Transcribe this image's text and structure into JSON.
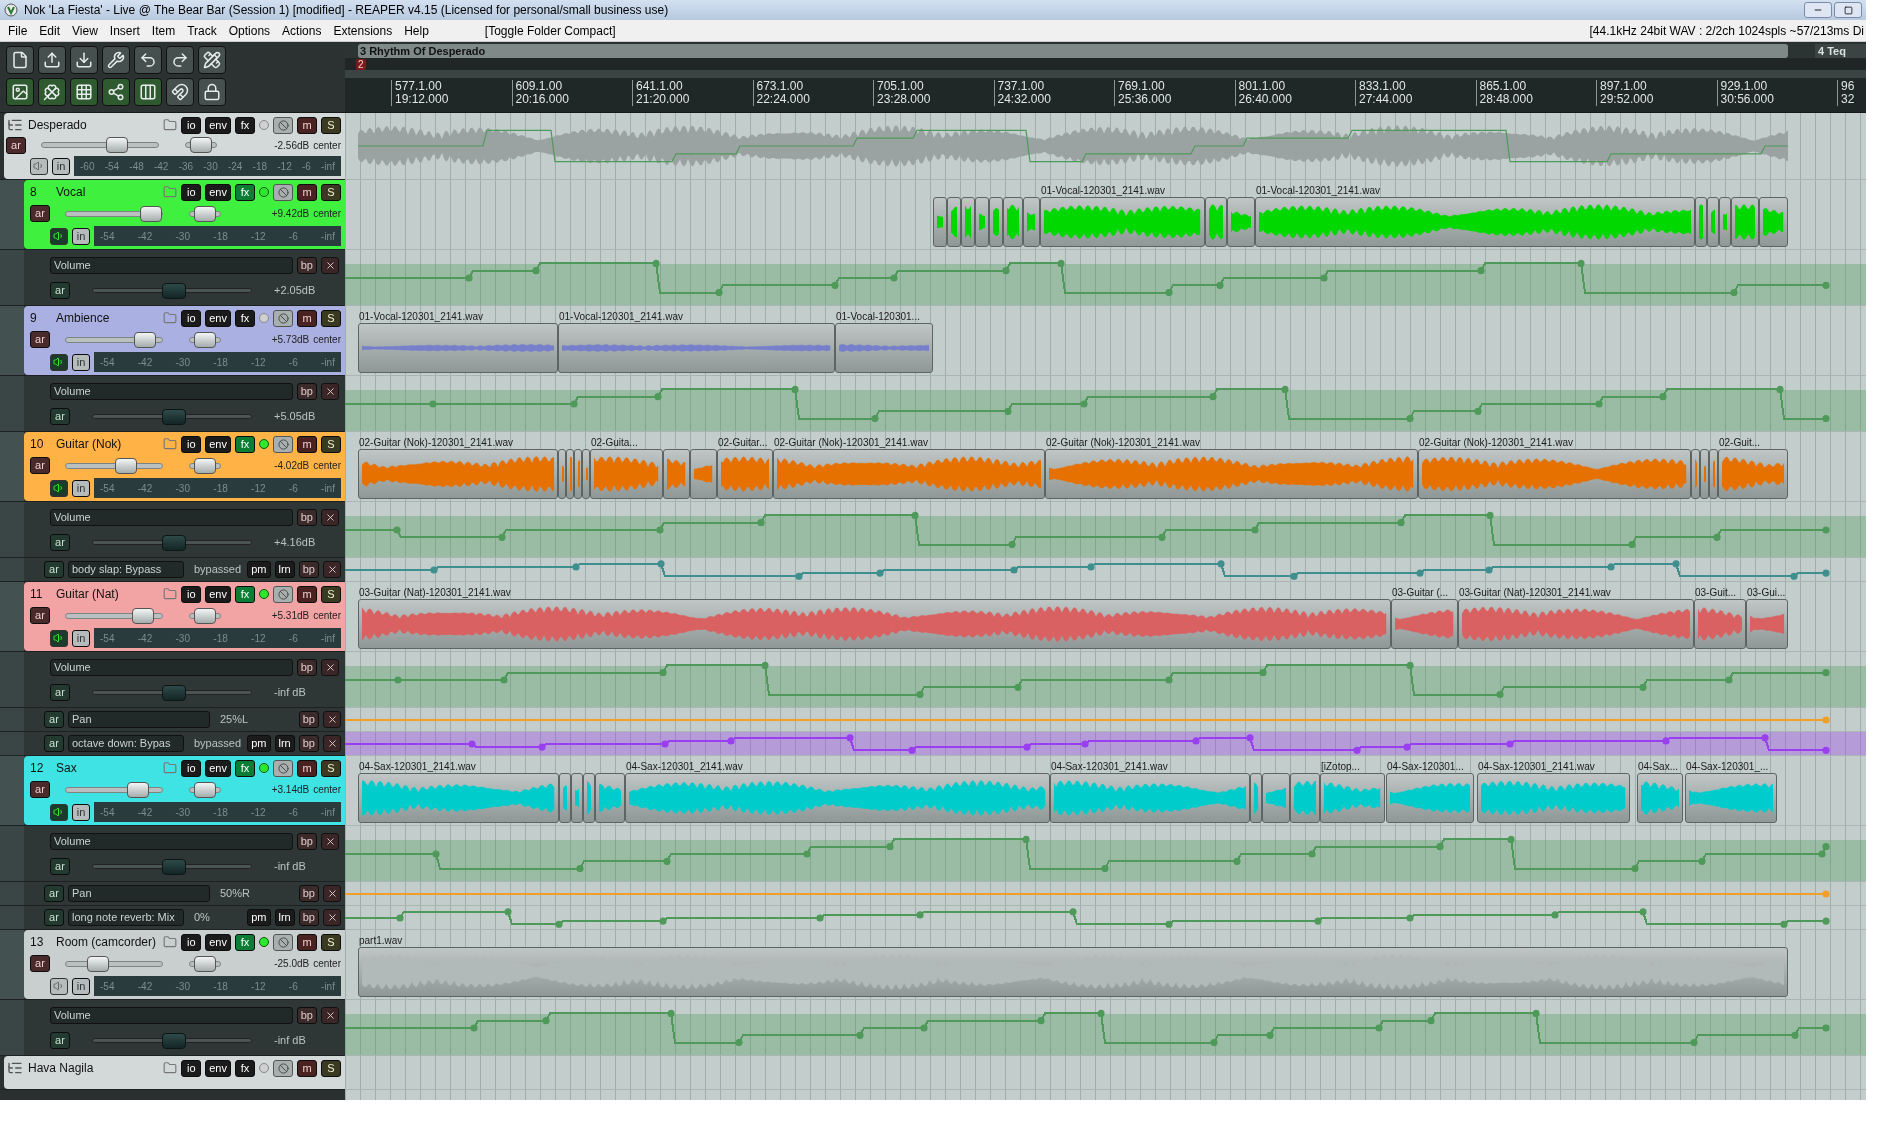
{
  "window": {
    "title": "Nok 'La Fiesta' - Live @ The Bear Bar (Session 1) [modified] - REAPER v4.15 (Licensed for personal/small business use)"
  },
  "menu": [
    {
      "label": "File"
    },
    {
      "label": "Edit"
    },
    {
      "label": "View"
    },
    {
      "label": "Insert"
    },
    {
      "label": "Item"
    },
    {
      "label": "Track"
    },
    {
      "label": "Options"
    },
    {
      "label": "Actions"
    },
    {
      "label": "Extensions"
    },
    {
      "label": "Help"
    }
  ],
  "menu_extra": "[Toggle Folder Compact]",
  "status": "[44.1kHz 24bit WAV : 2/2ch 1024spls ~57/213ms Di",
  "regions": [
    {
      "label": "3 Rhythm Of Desperado"
    },
    {
      "label": "4 Teq"
    }
  ],
  "marker": "2",
  "ruler": [
    {
      "bar": "577.1.00",
      "time": "19:12.000"
    },
    {
      "bar": "609.1.00",
      "time": "20:16.000"
    },
    {
      "bar": "641.1.00",
      "time": "21:20.000"
    },
    {
      "bar": "673.1.00",
      "time": "22:24.000"
    },
    {
      "bar": "705.1.00",
      "time": "23:28.000"
    },
    {
      "bar": "737.1.00",
      "time": "24:32.000"
    },
    {
      "bar": "769.1.00",
      "time": "25:36.000"
    },
    {
      "bar": "801.1.00",
      "time": "26:40.000"
    },
    {
      "bar": "833.1.00",
      "time": "27:44.000"
    },
    {
      "bar": "865.1.00",
      "time": "28:48.000"
    },
    {
      "bar": "897.1.00",
      "time": "29:52.000"
    },
    {
      "bar": "929.1.00",
      "time": "30:56.000"
    },
    {
      "bar": "96",
      "time": "32"
    }
  ],
  "rows": [
    {
      "kind": "folder",
      "name": "Desperado",
      "color": "#d3d9d8",
      "io": "io",
      "env": "env",
      "fx": "fx",
      "fx_on": false,
      "mute": "m",
      "solo": "S",
      "arm": "ar",
      "input": "in",
      "monitor": false,
      "readout": "-2.56dB",
      "pan_label": "center",
      "fader": {
        "level": 0.65
      },
      "pan": {
        "level": 0.5
      },
      "scale": [
        "-60",
        "-54",
        "-48",
        "-42",
        "-36",
        "-30",
        "-24",
        "-18",
        "-12",
        "-6",
        "-inf"
      ]
    },
    {
      "kind": "track",
      "number": "8",
      "name": "Vocal",
      "color": "#3ff03f",
      "io": "io",
      "env": "env",
      "fx": "fx",
      "fx_on": true,
      "mute": "m",
      "solo": "S",
      "arm": "ar",
      "input": "in",
      "monitor": true,
      "readout": "+9.42dB",
      "pan_label": "center",
      "fader": {
        "level": 0.89
      },
      "pan": {
        "level": 0.5
      },
      "scale": [
        "-54",
        "-42",
        "-30",
        "-18",
        "-12",
        "-6",
        "-inf"
      ],
      "items": [
        {
          "label": "01-Vocal-120301_2141.wav"
        },
        {
          "label": "01-Vocal-120301_2141.wav"
        }
      ]
    },
    {
      "kind": "envelope",
      "label": "Volume",
      "arm": "ar",
      "bypass": "bp",
      "readout": "+2.05dB",
      "fader": {
        "level": 0.51
      },
      "color": "#4f9a5a",
      "band": true
    },
    {
      "kind": "track",
      "number": "9",
      "name": "Ambience",
      "color": "#aab0e2",
      "io": "io",
      "env": "env",
      "fx": "fx",
      "fx_on": false,
      "mute": "m",
      "solo": "S",
      "arm": "ar",
      "input": "in",
      "monitor": true,
      "readout": "+5.73dB",
      "pan_label": "center",
      "fader": {
        "level": 0.82
      },
      "pan": {
        "level": 0.5
      },
      "scale": [
        "-54",
        "-42",
        "-30",
        "-18",
        "-12",
        "-6",
        "-inf"
      ],
      "items": [
        {
          "label": "01-Vocal-120301_2141.wav"
        },
        {
          "label": "01-Vocal-120301_2141.wav"
        },
        {
          "label": "01-Vocal-120301..."
        }
      ]
    },
    {
      "kind": "envelope",
      "label": "Volume",
      "arm": "ar",
      "bypass": "bp",
      "readout": "+5.05dB",
      "fader": {
        "level": 0.51
      },
      "color": "#4f9a5a",
      "band": true
    },
    {
      "kind": "track",
      "number": "10",
      "name": "Guitar (Nok)",
      "color": "#ffb347",
      "io": "io",
      "env": "env",
      "fx": "fx",
      "fx_on": true,
      "mute": "m",
      "solo": "S",
      "arm": "ar",
      "input": "in",
      "monitor": true,
      "readout": "-4.02dB",
      "pan_label": "center",
      "fader": {
        "level": 0.62
      },
      "pan": {
        "level": 0.5
      },
      "scale": [
        "-54",
        "-42",
        "-30",
        "-18",
        "-12",
        "-6",
        "-inf"
      ],
      "items": [
        {
          "label": "02-Guitar (Nok)-120301_2141.wav"
        },
        {
          "label": "02-Guita..."
        },
        {
          "label": "02-Guitar..."
        },
        {
          "label": "02-Guitar (Nok)-120301_2141.wav"
        },
        {
          "label": "02-Guitar (Nok)-120301_2141.wav"
        },
        {
          "label": "02-Guitar (Nok)-120301_2141.wav"
        },
        {
          "label": "02-Guit..."
        }
      ]
    },
    {
      "kind": "envelope",
      "label": "Volume",
      "arm": "ar",
      "bypass": "bp",
      "readout": "+4.16dB",
      "fader": {
        "level": 0.51
      },
      "color": "#4f9a5a",
      "band": true
    },
    {
      "kind": "fxparam",
      "label": "body slap: Bypass",
      "arm": "ar",
      "readout": "bypassed",
      "pm": "pm",
      "learn": "lrn",
      "bypass": "bp",
      "color": "#3f8f8f",
      "band": false
    },
    {
      "kind": "track",
      "number": "11",
      "name": "Guitar (Nat)",
      "color": "#f2a3a3",
      "io": "io",
      "env": "env",
      "fx": "fx",
      "fx_on": true,
      "mute": "m",
      "solo": "S",
      "arm": "ar",
      "input": "in",
      "monitor": true,
      "readout": "+5.31dB",
      "pan_label": "center",
      "fader": {
        "level": 0.8
      },
      "pan": {
        "level": 0.5
      },
      "scale": [
        "-54",
        "-42",
        "-30",
        "-18",
        "-12",
        "-6",
        "-inf"
      ],
      "items": [
        {
          "label": "03-Guitar (Nat)-120301_2141.wav"
        },
        {
          "label": "03-Guitar (..."
        },
        {
          "label": "03-Guitar (Nat)-120301_2141.wav"
        },
        {
          "label": "03-Guit..."
        },
        {
          "label": "03-Gui..."
        }
      ]
    },
    {
      "kind": "envelope",
      "label": "Volume",
      "arm": "ar",
      "bypass": "bp",
      "readout": "-inf dB",
      "fader": {
        "level": 0.51
      },
      "color": "#4f9a5a",
      "band": true
    },
    {
      "kind": "param",
      "label": "Pan",
      "arm": "ar",
      "bypass": "bp",
      "readout": "25%L",
      "color": "#f0a028",
      "band": false
    },
    {
      "kind": "fxparam",
      "label": "octave down: Bypas",
      "arm": "ar",
      "readout": "bypassed",
      "pm": "pm",
      "learn": "lrn",
      "bypass": "bp",
      "color": "#9a3ff0",
      "band": true
    },
    {
      "kind": "track",
      "number": "12",
      "name": "Sax",
      "color": "#3fe3e3",
      "io": "io",
      "env": "env",
      "fx": "fx",
      "fx_on": true,
      "mute": "m",
      "solo": "S",
      "arm": "ar",
      "input": "in",
      "monitor": true,
      "readout": "+3.14dB",
      "pan_label": "center",
      "fader": {
        "level": 0.75
      },
      "pan": {
        "level": 0.5
      },
      "scale": [
        "-54",
        "-42",
        "-30",
        "-18",
        "-12",
        "-6",
        "-inf"
      ],
      "items": [
        {
          "label": "04-Sax-120301_2141.wav"
        },
        {
          "label": "04-Sax-120301_2141.wav"
        },
        {
          "label": "04-Sax-120301_2141.wav"
        },
        {
          "label": "[iZotop..."
        },
        {
          "label": "04-Sax-120301..."
        },
        {
          "label": "04-Sax-120301_2141.wav"
        },
        {
          "label": "04-Sax..."
        },
        {
          "label": "04-Sax-120301_..."
        }
      ]
    },
    {
      "kind": "envelope",
      "label": "Volume",
      "arm": "ar",
      "bypass": "bp",
      "readout": "-inf dB",
      "fader": {
        "level": 0.51
      },
      "color": "#4f9a5a",
      "band": true
    },
    {
      "kind": "param",
      "label": "Pan",
      "arm": "ar",
      "bypass": "bp",
      "readout": "50%R",
      "color": "#f0a028",
      "band": false
    },
    {
      "kind": "fxparam",
      "label": "long note reverb: Mix",
      "arm": "ar",
      "readout": "0%",
      "pm": "pm",
      "learn": "lrn",
      "bypass": "bp",
      "color": "#4f9a5a",
      "band": false
    },
    {
      "kind": "track",
      "number": "13",
      "name": "Room (camcorder)",
      "color": "#c9cfce",
      "io": "io",
      "env": "env",
      "fx": "fx",
      "fx_on": true,
      "mute": "m",
      "solo": "S",
      "arm": "ar",
      "input": "in",
      "monitor": false,
      "readout": "-25.0dB",
      "pan_label": "center",
      "fader": {
        "level": 0.33
      },
      "pan": {
        "level": 0.5
      },
      "scale": [
        "-54",
        "-42",
        "-30",
        "-18",
        "-12",
        "-6",
        "-inf"
      ],
      "items": [
        {
          "label": "part1.wav"
        }
      ]
    },
    {
      "kind": "envelope",
      "label": "Volume",
      "arm": "ar",
      "bypass": "bp",
      "readout": "-inf dB",
      "fader": {
        "level": 0.51
      },
      "color": "#4f9a5a",
      "band": true
    },
    {
      "kind": "folder",
      "name": "Hava Nagila",
      "color": "#d3d9d8",
      "io": "io",
      "env": "env",
      "fx": "fx",
      "fx_on": false,
      "mute": "m",
      "solo": "S"
    }
  ]
}
